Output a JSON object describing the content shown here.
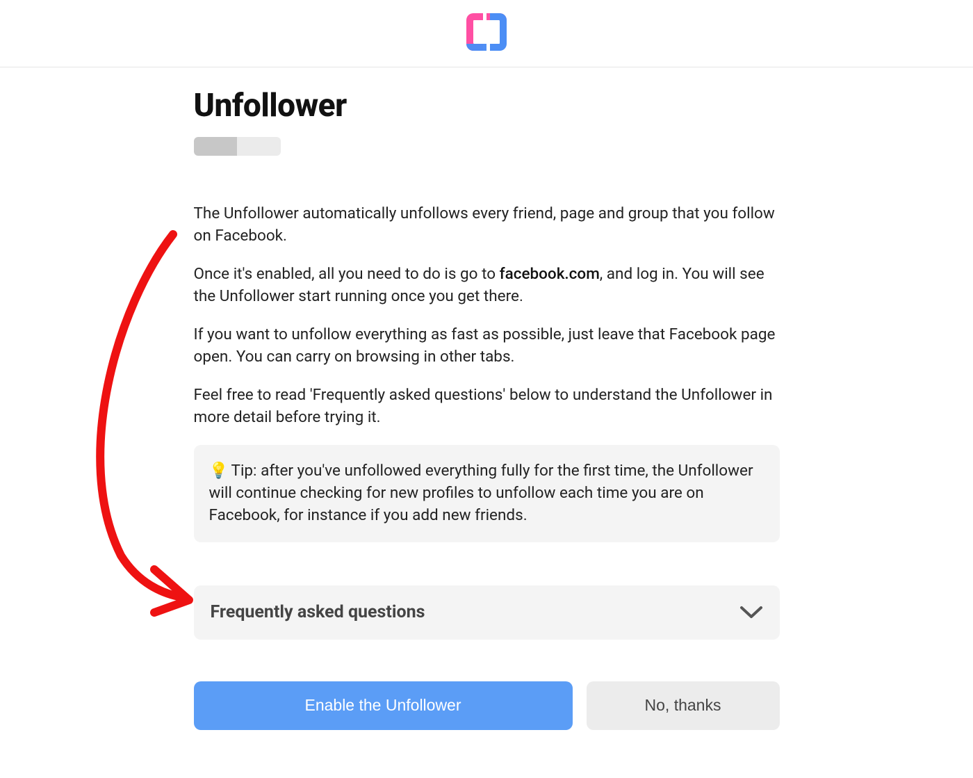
{
  "page": {
    "title": "Unfollower"
  },
  "body": {
    "p1": "The Unfollower automatically unfollows every friend, page and group that you follow on Facebook.",
    "p2a": "Once it's enabled, all you need to do is go to ",
    "p2_link": "facebook.com",
    "p2b": ", and log in. You will see the Unfollower start running once you get there.",
    "p3": "If you want to unfollow everything as fast as possible, just leave that Facebook page open. You can carry on browsing in other tabs.",
    "p4": "Feel free to read 'Frequently asked questions' below to understand the Unfollower in more detail before trying it."
  },
  "tip": {
    "text": "Tip: after you've unfollowed everything fully for the first time, the Unfollower will continue checking for new profiles to unfollow each time you are on Facebook, for instance if you add new friends."
  },
  "faq": {
    "title": "Frequently asked questions"
  },
  "buttons": {
    "enable": "Enable the Unfollower",
    "decline": "No, thanks"
  },
  "colors": {
    "primary_button": "#5b9df6",
    "secondary_button": "#ececec",
    "panel_bg": "#f4f4f4",
    "annotation_arrow": "#ee1212"
  }
}
